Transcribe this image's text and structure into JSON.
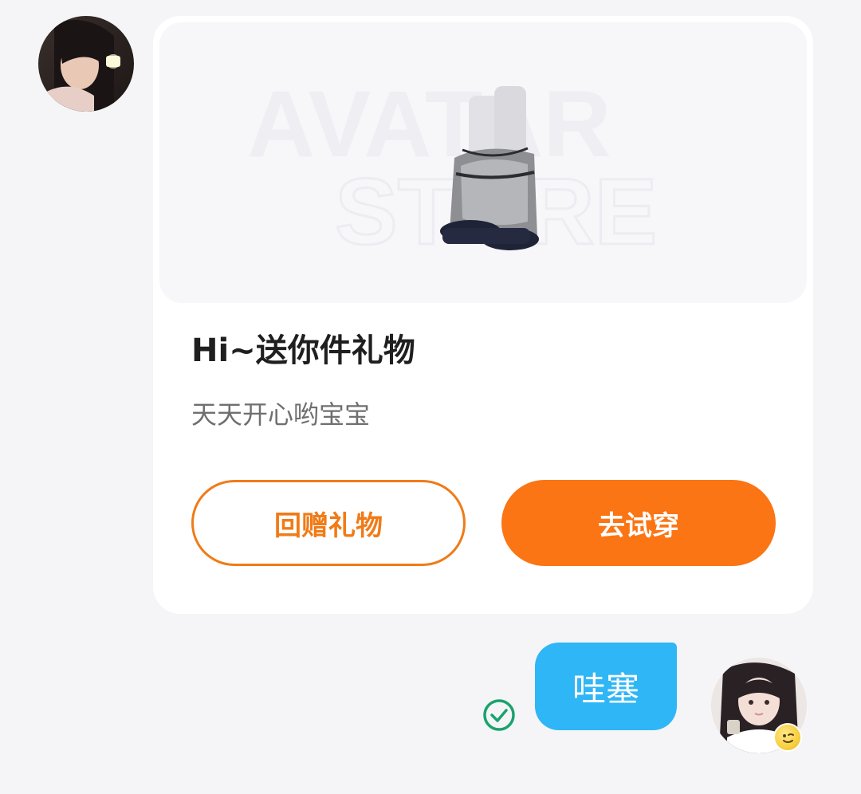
{
  "chat": {
    "incoming": {
      "sender_avatar": "avatar-photo"
    },
    "gift_card": {
      "banner": {
        "watermark_line1": "AVATAR",
        "watermark_line2": "STORE",
        "item_icon": "fur-boots-icon"
      },
      "title": "Hi~送你件礼物",
      "message": "天天开心哟宝宝",
      "buttons": {
        "return_gift": "回赠礼物",
        "try_on": "去试穿"
      }
    },
    "outgoing": {
      "text": "哇塞",
      "status_icon": "check-circle-icon",
      "sender_avatar": "avatar-photo",
      "badge_icon": "emoji-sticker-icon"
    }
  },
  "colors": {
    "background": "#f5f5f7",
    "card": "#ffffff",
    "banner": "#f7f7fa",
    "accent_orange": "#fb7514",
    "outline_orange": "#f07b17",
    "bubble_blue": "#2fb6f6",
    "read_green": "#1aa36d",
    "title_text": "#1f1f1f",
    "message_text": "#6f6f6f"
  }
}
